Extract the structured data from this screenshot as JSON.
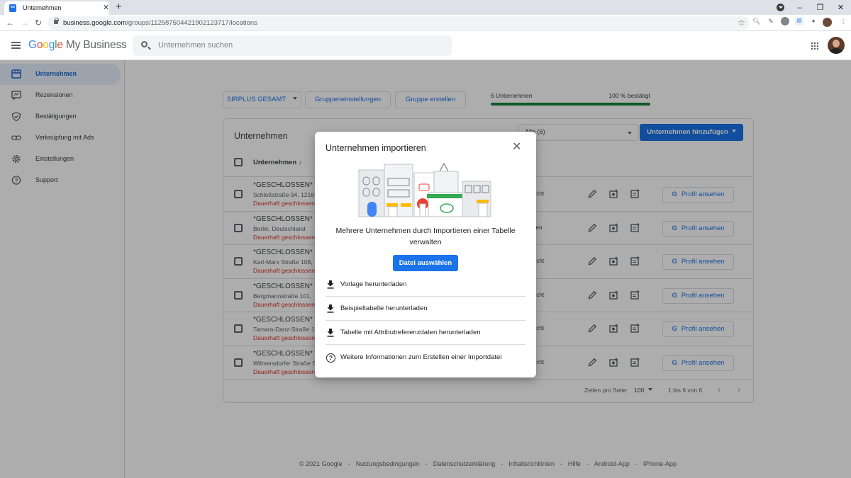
{
  "browser": {
    "tab_title": "Unternehmen",
    "tab_close": "✕",
    "new_tab": "+",
    "url_host": "business.google.com",
    "url_path": "/groups/112587504421902123717/locations",
    "win_min": "–",
    "win_restore": "❐",
    "win_close": "✕"
  },
  "header": {
    "logo_g": "G",
    "logo_o1": "o",
    "logo_o2": "o",
    "logo_g2": "g",
    "logo_l": "l",
    "logo_e": "e",
    "product": "My Business",
    "search_placeholder": "Unternehmen suchen"
  },
  "sidebar": {
    "items": [
      {
        "label": "Unternehmen",
        "icon": "store-icon",
        "active": true
      },
      {
        "label": "Rezensionen",
        "icon": "reviews-icon"
      },
      {
        "label": "Bestätigungen",
        "icon": "verified-shield-icon"
      },
      {
        "label": "Verknüpfung mit Ads",
        "icon": "link-icon"
      },
      {
        "label": "Einstellungen",
        "icon": "gear-icon"
      },
      {
        "label": "Support",
        "icon": "help-icon"
      }
    ]
  },
  "toolbar": {
    "group_name": "SIRPLUS GESAMT",
    "group_settings": "Gruppeneinstellungen",
    "create_group": "Gruppe erstellen",
    "count_label": "6 Unternehmen",
    "verified_label": "100 % bestätigt",
    "verified_fraction": 1.0
  },
  "card": {
    "title": "Unternehmen",
    "filter_value": "Alle (6)",
    "add_button": "Unternehmen hinzufügen",
    "column_name": "Unternehmen ↓",
    "profile_button": "Profil ansehen",
    "profile_g": "G",
    "rows": [
      {
        "name": "*GESCHLOSSEN* S",
        "address": "Schloßstraße 94, 1216",
        "closed": "Dauerhaft geschlossen",
        "status": "öffentlicht"
      },
      {
        "name": "*GESCHLOSSEN* S",
        "address": "Berlin, Deutschland",
        "closed": "Dauerhaft geschlossen",
        "status": "chlossen"
      },
      {
        "name": "*GESCHLOSSEN* S",
        "address": "Karl-Marx Straße 108,",
        "closed": "Dauerhaft geschlossen",
        "status": "öffentlicht"
      },
      {
        "name": "*GESCHLOSSEN* S",
        "address": "Bergmannstraße 101,",
        "closed": "Dauerhaft geschlossen",
        "status": "öffentlicht"
      },
      {
        "name": "*GESCHLOSSEN* S",
        "address": "Tamara-Danz-Straße 1",
        "closed": "Dauerhaft geschlossen",
        "status": "öffentlicht"
      },
      {
        "name": "*GESCHLOSSEN* S",
        "address": "Wilmersdorfer Straße S",
        "closed": "Dauerhaft geschlossen",
        "status": "öffentlicht"
      }
    ],
    "pager_label": "Zeilen pro Seite:",
    "pager_size": "100",
    "pager_range": "1 bis 6 von 6",
    "pager_prev": "‹",
    "pager_next": "›"
  },
  "footer": {
    "items": [
      "© 2021 Google",
      "Nutzungsbedingungen",
      "Datenschutzerklärung",
      "Inhaltsrichtlinien",
      "Hilfe",
      "Android-App",
      "iPhone-App"
    ],
    "separator": "-"
  },
  "dialog": {
    "title": "Unternehmen importieren",
    "close": "✕",
    "text": "Mehrere Unternehmen durch Importieren einer Tabelle verwalten",
    "primary_button": "Datei auswählen",
    "links": [
      {
        "label": "Vorlage herunterladen",
        "icon": "download-icon"
      },
      {
        "label": "Beispieltabelle herunterladen",
        "icon": "download-icon"
      },
      {
        "label": "Tabelle mit Attributreferenzdaten herunterladen",
        "icon": "download-icon"
      },
      {
        "label": "Weitere Informationen zum Erstellen einer Importdatei",
        "icon": "help-icon"
      }
    ],
    "help_glyph": "?"
  },
  "colors": {
    "accent": "#1a73e8",
    "progress": "#188038",
    "closed_text": "#d93025"
  }
}
